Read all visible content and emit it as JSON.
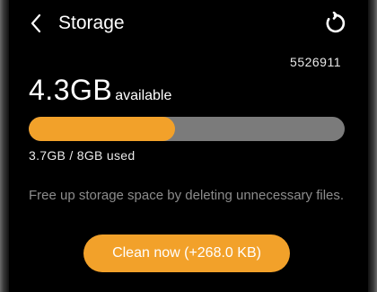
{
  "header": {
    "title": "Storage",
    "back_icon": "chevron-left-icon",
    "refresh_icon": "refresh-icon"
  },
  "code": "5526911",
  "storage": {
    "available_value": "4.3GB",
    "available_label": "available",
    "used_text": "3.7GB / 8GB used",
    "used_fraction": 0.4625
  },
  "description": "Free up storage space by deleting unnecessary files.",
  "clean_button": {
    "label": "Clean now (+268.0 KB)"
  },
  "colors": {
    "accent": "#f2a12a",
    "bar_track": "#7b7b7b",
    "background": "#000000"
  }
}
